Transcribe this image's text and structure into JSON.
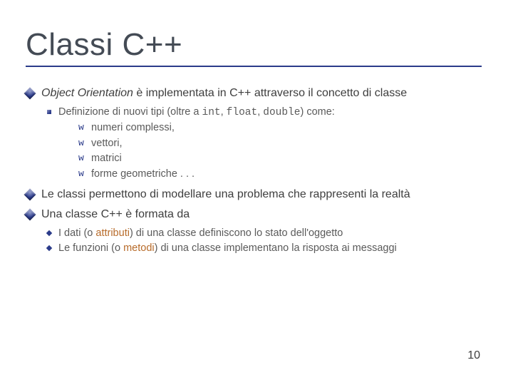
{
  "title": "Classi C++",
  "pagenum": "10",
  "p1a": "Object Orientation",
  "p1b": " è implementata in C++ attraverso il concetto di classe",
  "p2a": "Definizione di nuovi tipi (oltre a ",
  "p2b": "int",
  "p2c": ", ",
  "p2d": "float",
  "p2e": ", ",
  "p2f": "double",
  "p2g": ") come:",
  "p2_items": {
    "0": "numeri complessi,",
    "1": "vettori,",
    "2": "matrici",
    "3": "forme geometriche  . . ."
  },
  "p3": "Le classi permettono di modellare una problema che rappresenti la realtà",
  "p4": "Una classe C++ è formata da",
  "p5a": "I dati (o ",
  "p5b": "attributi",
  "p5c": ") di una classe definiscono lo stato dell'oggetto",
  "p6a": "Le funzioni (o ",
  "p6b": "metodi",
  "p6c": ") di una classe implementano la risposta ai messaggi"
}
